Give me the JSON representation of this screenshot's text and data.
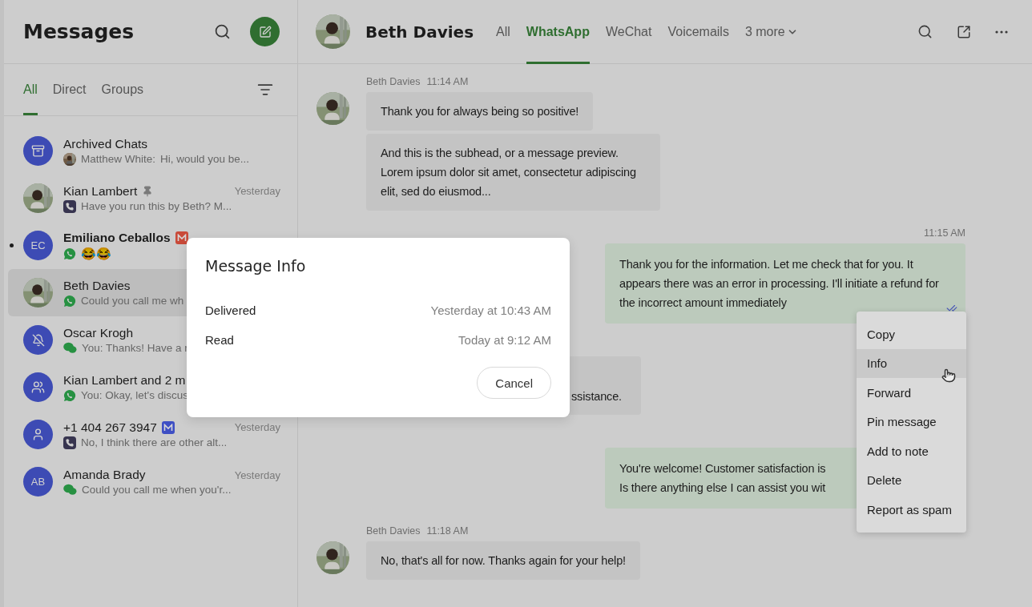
{
  "sidebar": {
    "title": "Messages",
    "tabs": [
      {
        "label": "All",
        "selected": true
      },
      {
        "label": "Direct",
        "selected": false
      },
      {
        "label": "Groups",
        "selected": false
      }
    ],
    "chats": [
      {
        "name": "Archived Chats",
        "avatar": {
          "kind": "archive"
        },
        "preview_sender": "Matthew White:",
        "preview": "Hi, would you be...",
        "selected": false,
        "unread": false
      },
      {
        "name": "Kian Lambert",
        "preview_icon": {
          "kind": "phone"
        },
        "preview": "Have you run this by Beth? M...",
        "time": "Yesterday",
        "pinned": true,
        "selected": false,
        "unread": false
      },
      {
        "name": "Emiliano Ceballos",
        "avatar": {
          "kind": "initials",
          "initials": "EC"
        },
        "preview_icon": {
          "kind": "whatsapp"
        },
        "preview": "😂😂",
        "badge": {
          "color": "#c94a39"
        },
        "selected": false,
        "unread": true
      },
      {
        "name": "Beth Davies",
        "preview_icon": {
          "kind": "whatsapp"
        },
        "preview": "Could you call me wh",
        "selected": true,
        "unread": false
      },
      {
        "name": "Oscar Krogh",
        "avatar": {
          "kind": "muted"
        },
        "preview_icon": {
          "kind": "wechat"
        },
        "preview": "You: Thanks! Have a r",
        "selected": false,
        "unread": false
      },
      {
        "name": "Kian Lambert and 2 m",
        "avatar": {
          "kind": "group"
        },
        "preview_icon": {
          "kind": "whatsapp"
        },
        "preview": "You: Okay, let's discus",
        "selected": false,
        "unread": false
      },
      {
        "name": "+1 404 267 3947",
        "avatar": {
          "kind": "person"
        },
        "preview_icon": {
          "kind": "phone"
        },
        "preview": "No, I think there are other alt...",
        "time": "Yesterday",
        "badge": {
          "color": "#3e4fc4"
        },
        "selected": false,
        "unread": false
      },
      {
        "name": "Amanda Brady",
        "avatar": {
          "kind": "initials",
          "initials": "AB"
        },
        "preview_icon": {
          "kind": "wechat"
        },
        "preview": "Could you call me when you'r...",
        "time": "Yesterday",
        "selected": false,
        "unread": false
      }
    ]
  },
  "conversation": {
    "contact": "Beth Davies",
    "tabs": [
      {
        "label": "All",
        "selected": false
      },
      {
        "label": "WhatsApp",
        "selected": true
      },
      {
        "label": "WeChat",
        "selected": false
      },
      {
        "label": "Voicemails",
        "selected": false
      }
    ],
    "more_tab": "3 more",
    "messages": [
      {
        "kind": "incoming",
        "sender": "Beth Davies",
        "time": "11:14 AM",
        "bubbles": [
          "Thank you for always being so positive!",
          "And this is the subhead, or a message preview. Lorem ipsum dolor sit amet, consectetur adipiscing elit, sed do eiusmod..."
        ]
      },
      {
        "kind": "outgoing",
        "time": "11:15 AM",
        "read": true,
        "bubbles": [
          "Thank you for the information. Let me check that for you. It appears there was an error in processing. I'll initiate a refund for the incorrect amount immediately"
        ]
      },
      {
        "kind": "incoming",
        "partial": true,
        "bubbles": [
          "ssistance."
        ]
      },
      {
        "kind": "outgoing",
        "bubbles": [
          "You're welcome! Customer satisfaction is\nIs there anything else I can assist you wit"
        ]
      },
      {
        "kind": "incoming",
        "sender": "Beth Davies",
        "time": "11:18 AM",
        "bubbles": [
          "No, that's all for now. Thanks again for your help!"
        ]
      }
    ]
  },
  "context_menu": {
    "items": [
      {
        "label": "Copy",
        "selected": false
      },
      {
        "label": "Info",
        "selected": true
      },
      {
        "label": "Forward",
        "selected": false
      },
      {
        "label": "Pin message",
        "selected": false
      },
      {
        "label": "Add to note",
        "selected": false
      },
      {
        "label": "Delete",
        "selected": false
      },
      {
        "label": "Report as spam",
        "selected": false
      }
    ]
  },
  "dialog": {
    "title": "Message Info",
    "rows": [
      {
        "label": "Delivered",
        "value": "Yesterday at 10:43 AM"
      },
      {
        "label": "Read",
        "value": "Today at 9:12 AM"
      }
    ],
    "cancel": "Cancel"
  }
}
